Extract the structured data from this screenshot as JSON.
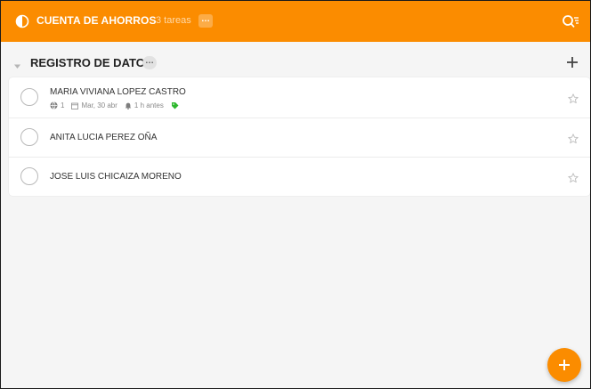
{
  "colors": {
    "accent": "#fb8c00",
    "label_green": "#2eb82e"
  },
  "header": {
    "project_title": "CUENTA DE AHORROS",
    "task_count": "3 tareas",
    "more": "…",
    "project_icon": "project-half-circle-icon",
    "search_icon": "search-filter-icon"
  },
  "section": {
    "title": "REGISTRO DE DATOS",
    "more": "…",
    "collapse_icon": "chevron-down-icon",
    "add_icon": "plus-icon"
  },
  "tasks": [
    {
      "name": "MARIA VIVIANA LOPEZ CASTRO",
      "comments": "1",
      "due_date": "Mar, 30 abr",
      "reminder": "1 h antes",
      "has_label": true
    },
    {
      "name": "ANITA LUCIA PEREZ OÑA"
    },
    {
      "name": "JOSE LUIS CHICAIZA MORENO"
    }
  ],
  "fab": {
    "icon": "plus-icon"
  }
}
